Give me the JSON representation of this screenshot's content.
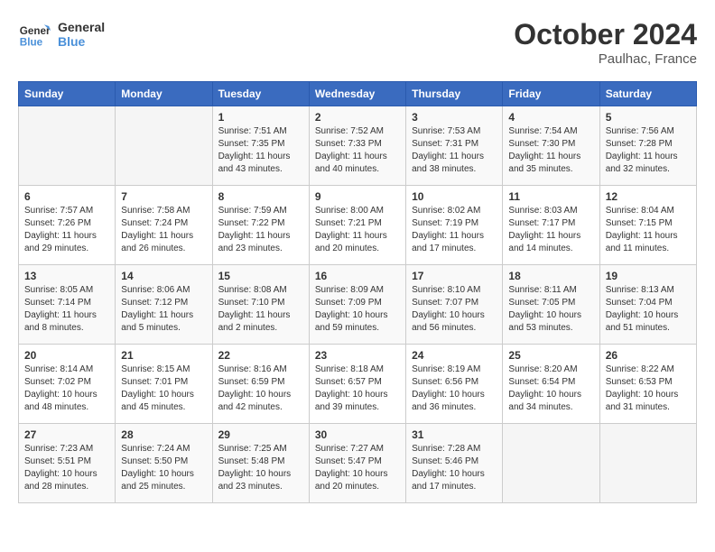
{
  "header": {
    "logo_general": "General",
    "logo_blue": "Blue",
    "month": "October 2024",
    "location": "Paulhac, France"
  },
  "weekdays": [
    "Sunday",
    "Monday",
    "Tuesday",
    "Wednesday",
    "Thursday",
    "Friday",
    "Saturday"
  ],
  "weeks": [
    [
      {
        "day": "",
        "info": ""
      },
      {
        "day": "",
        "info": ""
      },
      {
        "day": "1",
        "info": "Sunrise: 7:51 AM\nSunset: 7:35 PM\nDaylight: 11 hours and 43 minutes."
      },
      {
        "day": "2",
        "info": "Sunrise: 7:52 AM\nSunset: 7:33 PM\nDaylight: 11 hours and 40 minutes."
      },
      {
        "day": "3",
        "info": "Sunrise: 7:53 AM\nSunset: 7:31 PM\nDaylight: 11 hours and 38 minutes."
      },
      {
        "day": "4",
        "info": "Sunrise: 7:54 AM\nSunset: 7:30 PM\nDaylight: 11 hours and 35 minutes."
      },
      {
        "day": "5",
        "info": "Sunrise: 7:56 AM\nSunset: 7:28 PM\nDaylight: 11 hours and 32 minutes."
      }
    ],
    [
      {
        "day": "6",
        "info": "Sunrise: 7:57 AM\nSunset: 7:26 PM\nDaylight: 11 hours and 29 minutes."
      },
      {
        "day": "7",
        "info": "Sunrise: 7:58 AM\nSunset: 7:24 PM\nDaylight: 11 hours and 26 minutes."
      },
      {
        "day": "8",
        "info": "Sunrise: 7:59 AM\nSunset: 7:22 PM\nDaylight: 11 hours and 23 minutes."
      },
      {
        "day": "9",
        "info": "Sunrise: 8:00 AM\nSunset: 7:21 PM\nDaylight: 11 hours and 20 minutes."
      },
      {
        "day": "10",
        "info": "Sunrise: 8:02 AM\nSunset: 7:19 PM\nDaylight: 11 hours and 17 minutes."
      },
      {
        "day": "11",
        "info": "Sunrise: 8:03 AM\nSunset: 7:17 PM\nDaylight: 11 hours and 14 minutes."
      },
      {
        "day": "12",
        "info": "Sunrise: 8:04 AM\nSunset: 7:15 PM\nDaylight: 11 hours and 11 minutes."
      }
    ],
    [
      {
        "day": "13",
        "info": "Sunrise: 8:05 AM\nSunset: 7:14 PM\nDaylight: 11 hours and 8 minutes."
      },
      {
        "day": "14",
        "info": "Sunrise: 8:06 AM\nSunset: 7:12 PM\nDaylight: 11 hours and 5 minutes."
      },
      {
        "day": "15",
        "info": "Sunrise: 8:08 AM\nSunset: 7:10 PM\nDaylight: 11 hours and 2 minutes."
      },
      {
        "day": "16",
        "info": "Sunrise: 8:09 AM\nSunset: 7:09 PM\nDaylight: 10 hours and 59 minutes."
      },
      {
        "day": "17",
        "info": "Sunrise: 8:10 AM\nSunset: 7:07 PM\nDaylight: 10 hours and 56 minutes."
      },
      {
        "day": "18",
        "info": "Sunrise: 8:11 AM\nSunset: 7:05 PM\nDaylight: 10 hours and 53 minutes."
      },
      {
        "day": "19",
        "info": "Sunrise: 8:13 AM\nSunset: 7:04 PM\nDaylight: 10 hours and 51 minutes."
      }
    ],
    [
      {
        "day": "20",
        "info": "Sunrise: 8:14 AM\nSunset: 7:02 PM\nDaylight: 10 hours and 48 minutes."
      },
      {
        "day": "21",
        "info": "Sunrise: 8:15 AM\nSunset: 7:01 PM\nDaylight: 10 hours and 45 minutes."
      },
      {
        "day": "22",
        "info": "Sunrise: 8:16 AM\nSunset: 6:59 PM\nDaylight: 10 hours and 42 minutes."
      },
      {
        "day": "23",
        "info": "Sunrise: 8:18 AM\nSunset: 6:57 PM\nDaylight: 10 hours and 39 minutes."
      },
      {
        "day": "24",
        "info": "Sunrise: 8:19 AM\nSunset: 6:56 PM\nDaylight: 10 hours and 36 minutes."
      },
      {
        "day": "25",
        "info": "Sunrise: 8:20 AM\nSunset: 6:54 PM\nDaylight: 10 hours and 34 minutes."
      },
      {
        "day": "26",
        "info": "Sunrise: 8:22 AM\nSunset: 6:53 PM\nDaylight: 10 hours and 31 minutes."
      }
    ],
    [
      {
        "day": "27",
        "info": "Sunrise: 7:23 AM\nSunset: 5:51 PM\nDaylight: 10 hours and 28 minutes."
      },
      {
        "day": "28",
        "info": "Sunrise: 7:24 AM\nSunset: 5:50 PM\nDaylight: 10 hours and 25 minutes."
      },
      {
        "day": "29",
        "info": "Sunrise: 7:25 AM\nSunset: 5:48 PM\nDaylight: 10 hours and 23 minutes."
      },
      {
        "day": "30",
        "info": "Sunrise: 7:27 AM\nSunset: 5:47 PM\nDaylight: 10 hours and 20 minutes."
      },
      {
        "day": "31",
        "info": "Sunrise: 7:28 AM\nSunset: 5:46 PM\nDaylight: 10 hours and 17 minutes."
      },
      {
        "day": "",
        "info": ""
      },
      {
        "day": "",
        "info": ""
      }
    ]
  ]
}
